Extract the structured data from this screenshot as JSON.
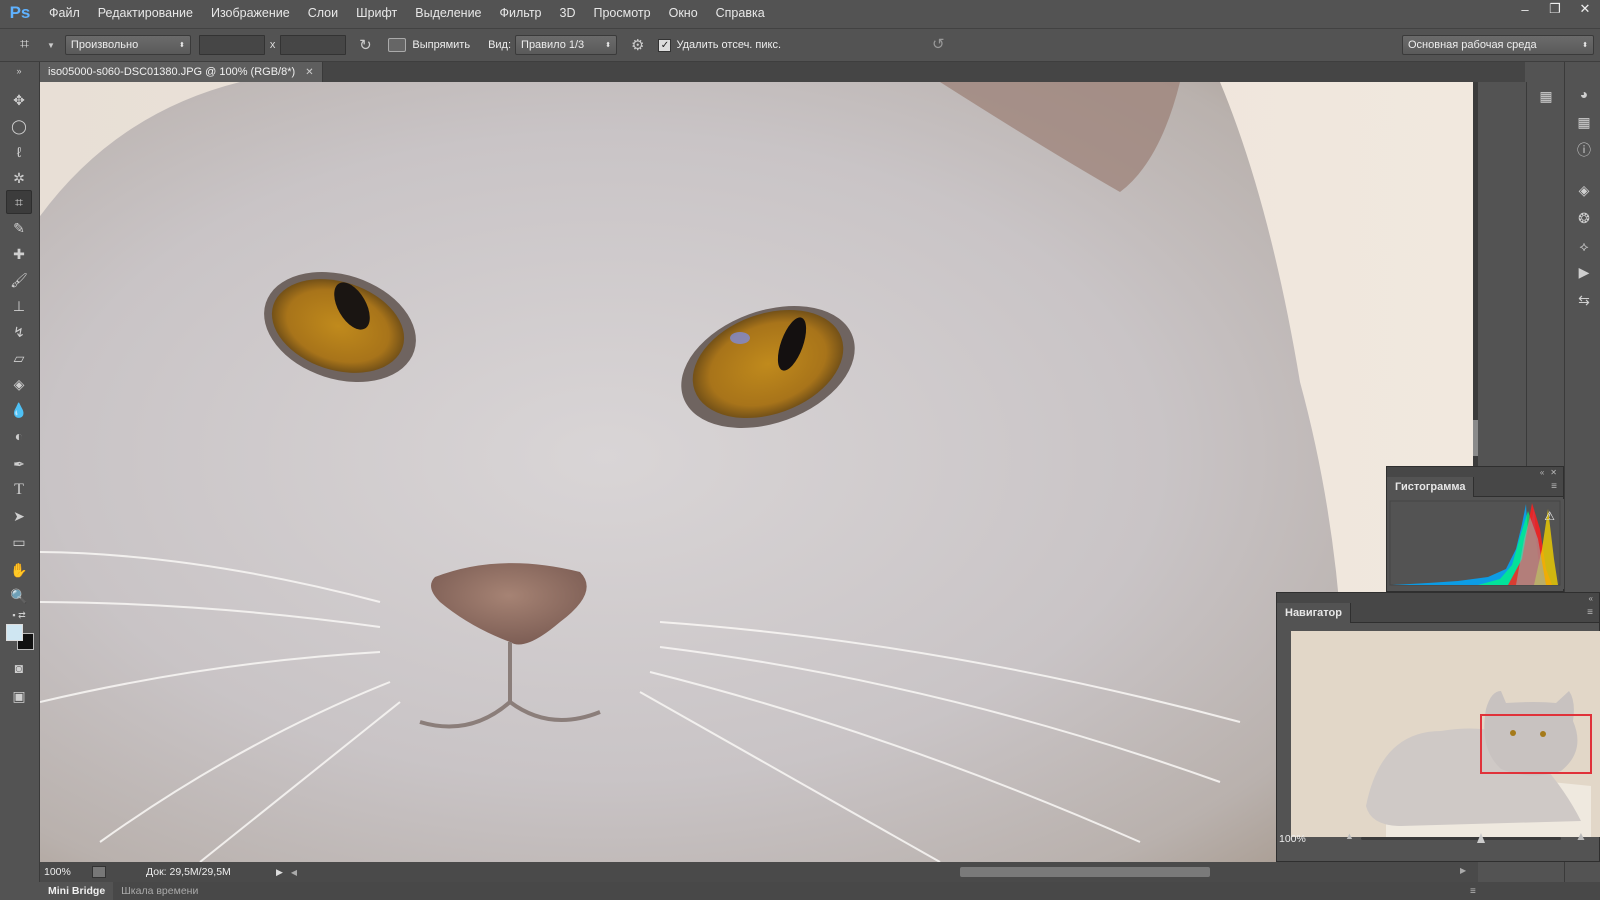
{
  "app": {
    "logo": "Ps"
  },
  "menu": [
    "Файл",
    "Редактирование",
    "Изображение",
    "Слои",
    "Шрифт",
    "Выделение",
    "Фильтр",
    "3D",
    "Просмотр",
    "Окно",
    "Справка"
  ],
  "options": {
    "ratio": "Произвольно",
    "times": "x",
    "straighten": "Выпрямить",
    "view_label": "Вид:",
    "view_value": "Правило 1/3",
    "delete_cropped": "Удалить отсеч. пикс.",
    "workspace": "Основная рабочая среда"
  },
  "document": {
    "tab_title": "iso05000-s060-DSC01380.JPG @ 100% (RGB/8*)",
    "zoom": "100%",
    "doc_info": "Док: 29,5M/29,5M"
  },
  "panels": {
    "histogram": {
      "title": "Гистограмма",
      "warning_icon": "warning-icon"
    },
    "navigator": {
      "title": "Навигатор",
      "zoom": "100%",
      "zoom_slider_fraction": 0.6
    }
  },
  "bottom_tabs": [
    "Mini Bridge",
    "Шкала времени"
  ],
  "colors": {
    "foreground": "#cfe6f2",
    "background": "#111111",
    "accent_blue": "#5fb2ff",
    "nav_box": "#e0323a"
  }
}
